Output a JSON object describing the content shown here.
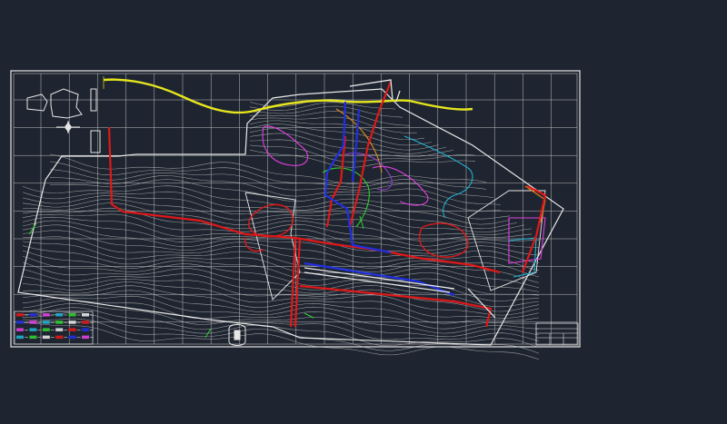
{
  "app": {
    "background": "#1f2530"
  },
  "drawing": {
    "frame_color": "#e6e6e6",
    "grid_color": "#d8d8d8",
    "contour_color": "#cfcfcf",
    "title_block": {
      "line1": "",
      "line2": ""
    },
    "layers": {
      "road": "#e6e61e",
      "pipe_red": "#e01818",
      "pipe_blue": "#2030e0",
      "pipe_magenta": "#e040e0",
      "pipe_cyan": "#20b0d0",
      "pipe_green": "#30d030",
      "pipe_orange": "#e08a20",
      "pipe_purple": "#9040d0"
    },
    "icons": [
      "location-inset-icon",
      "north-arrow-icon",
      "scale-marker-icon"
    ]
  }
}
